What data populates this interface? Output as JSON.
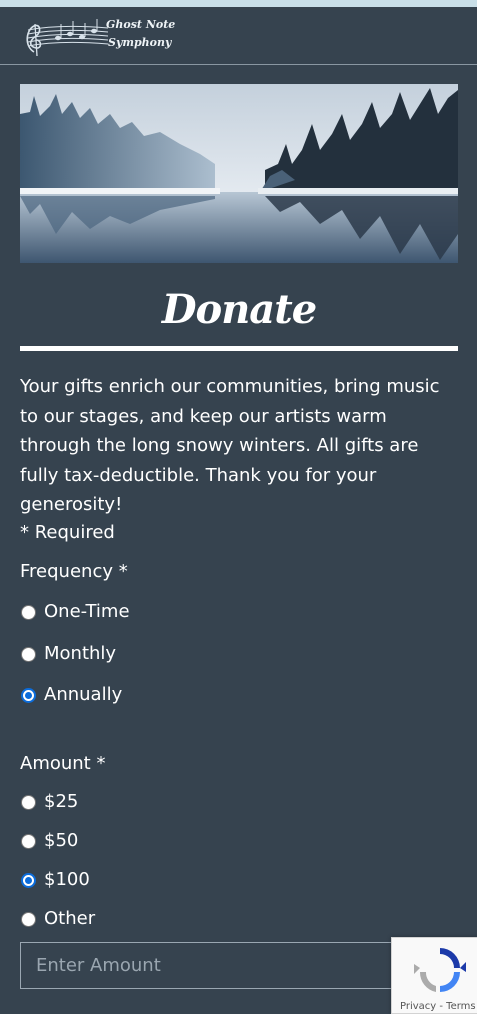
{
  "header": {
    "logo_line1": "Ghost Note",
    "logo_line2": "Symphony"
  },
  "page": {
    "title": "Donate",
    "intro": "Your gifts enrich our communities, bring music to our stages, and keep our artists warm through the long snowy winters. All gifts are fully tax-deductible. Thank you for your generosity!",
    "required_note": "* Required"
  },
  "frequency": {
    "label": "Frequency  *",
    "options": [
      "One-Time",
      "Monthly",
      "Annually"
    ],
    "selected": "Annually"
  },
  "amount": {
    "label": "Amount  *",
    "options": [
      "$25",
      "$50",
      "$100",
      "Other"
    ],
    "selected": "$100",
    "input_placeholder": "Enter Amount",
    "input_value": ""
  },
  "recaptcha": {
    "links": "Privacy - Terms"
  },
  "colors": {
    "background": "#36434f",
    "accent_radio": "#0b6cdb",
    "top_strip": "#c9dfe8"
  }
}
